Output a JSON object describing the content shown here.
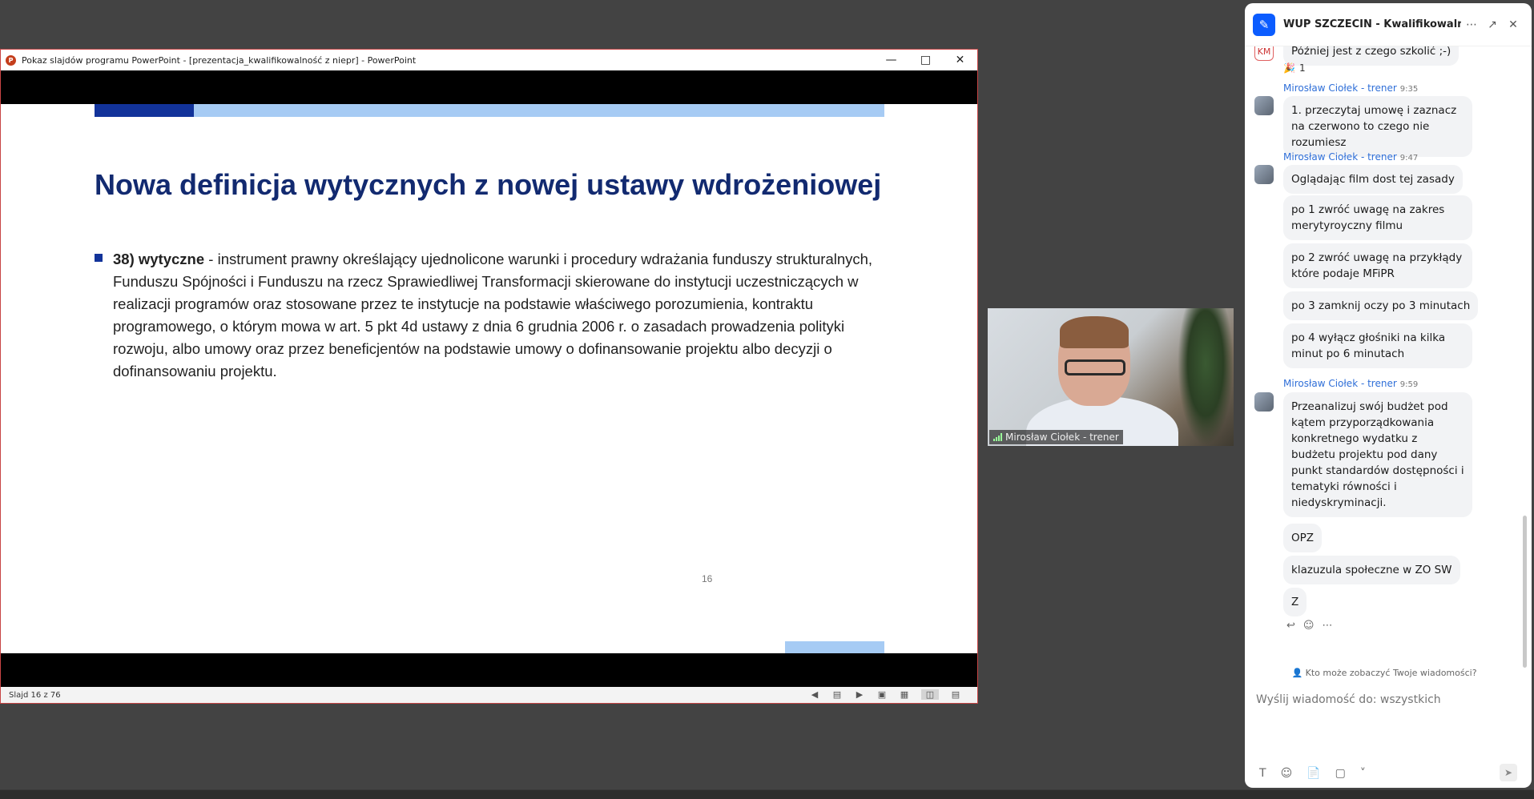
{
  "ppt": {
    "window_title": "Pokaz slajdów programu PowerPoint - [prezentacja_kwalifikowalność z niepr] - PowerPoint",
    "logo_letter": "P",
    "slide": {
      "title": "Nowa definicja wytycznych z nowej ustawy wdrożeniowej",
      "body_term": "38) wytyczne",
      "body_text": " - instrument prawny określający ujednolicone warunki i procedury wdrażania funduszy strukturalnych, Funduszu Spójności i Funduszu na rzecz Sprawiedliwej Transformacji skierowane do instytucji uczestniczących w realizacji programów oraz stosowane przez te instytucje na podstawie właściwego porozumienia, kontraktu programowego, o którym mowa w art. 5 pkt 4d ustawy z dnia 6 grudnia 2006 r. o zasadach prowadzenia polityki rozwoju, albo umowy oraz przez beneficjentów na podstawie umowy o dofinansowanie projektu albo decyzji o dofinansowaniu projektu.",
      "page_number": "16"
    },
    "status_text": "Slajd 16 z 76"
  },
  "video": {
    "participant_label": "Mirosław Ciołek - trener"
  },
  "chat": {
    "title": "WUP SZCZECIN - Kwalifikowalno...",
    "messages": {
      "m0": {
        "text": "Później jest z czego szkolić ;-)",
        "avatar": "KM"
      },
      "m0_reaction": {
        "emoji": "🎉",
        "count": "1"
      },
      "s1": {
        "name": "Mirosław Ciołek - trener",
        "time": "9:35"
      },
      "m1": {
        "text": "1. przeczytaj umowę i zaznacz na czerwono to czego nie rozumiesz"
      },
      "s2": {
        "name": "Mirosław Ciołek - trener",
        "time": "9:47"
      },
      "m2": {
        "text": "Oglądając film dost tej zasady"
      },
      "m3": {
        "text": "po 1 zwróć uwagę na zakres merytyroyczny filmu"
      },
      "m4": {
        "text": "po 2 zwróć uwagę na przykłądy które podaje MFiPR"
      },
      "m5": {
        "text": "po 3 zamknij oczy po 3 minutach"
      },
      "m6": {
        "text": "po 4 wyłącz głośniki na kilka minut po 6 minutach"
      },
      "s3": {
        "name": "Mirosław Ciołek - trener",
        "time": "9:59"
      },
      "m7": {
        "text": "Przeanalizuj swój budżet pod kątem przyporządkowania konkretnego wydatku z budżetu projektu pod dany punkt standardów dostępności i tematyki równości i niedyskryminacji."
      },
      "m8": {
        "text": "OPZ"
      },
      "m9": {
        "text": "klazuzula społeczne w ZO SW"
      },
      "m10": {
        "text": "Z"
      }
    },
    "privacy_text": "Kto może zobaczyć Twoje wiadomości?",
    "input_placeholder": "Wyślij wiadomość do: wszystkich"
  },
  "colors": {
    "slide_title": "#122a70",
    "slide_accent_dark": "#12339a",
    "slide_accent_light": "#a6cbf4",
    "chat_sender": "#2f6fd8",
    "zoom_blue": "#0b5cff"
  }
}
